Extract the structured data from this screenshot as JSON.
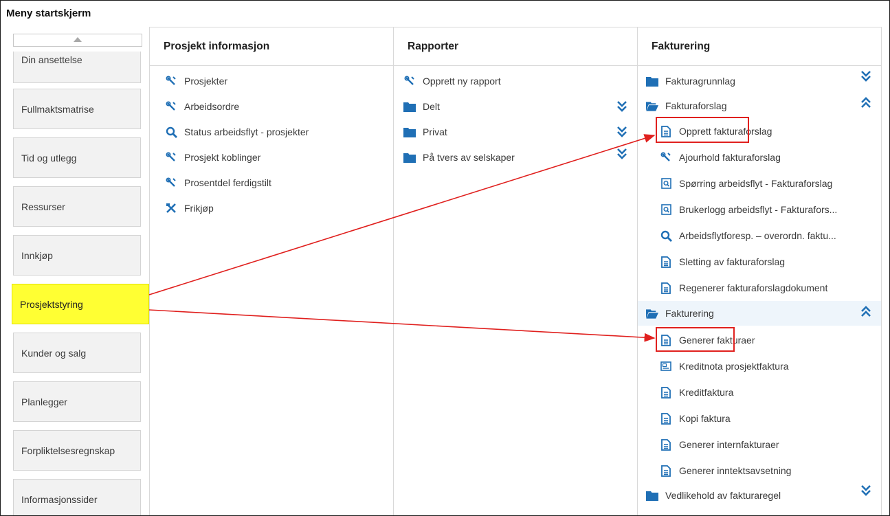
{
  "window_title": "Meny startskjerm",
  "sidebar": {
    "items": [
      {
        "label": "Din ansettelse"
      },
      {
        "label": "Fullmaktsmatrise"
      },
      {
        "label": "Tid og utlegg"
      },
      {
        "label": "Ressurser"
      },
      {
        "label": "Innkjøp"
      },
      {
        "label": "Prosjektstyring",
        "active": true
      },
      {
        "label": "Kunder og salg"
      },
      {
        "label": "Planlegger"
      },
      {
        "label": "Forpliktelsesregnskap"
      },
      {
        "label": "Informasjonssider"
      }
    ]
  },
  "columns": {
    "prosjekt": {
      "title": "Prosjekt informasjon",
      "items": [
        {
          "label": "Prosjekter",
          "icon": "tools-icon"
        },
        {
          "label": "Arbeidsordre",
          "icon": "tools-icon"
        },
        {
          "label": "Status arbeidsflyt - prosjekter",
          "icon": "search-icon"
        },
        {
          "label": "Prosjekt koblinger",
          "icon": "tools-icon"
        },
        {
          "label": "Prosentdel ferdigstilt",
          "icon": "tools-icon"
        },
        {
          "label": "Frikjøp",
          "icon": "tools-cross-icon"
        }
      ]
    },
    "rapporter": {
      "title": "Rapporter",
      "items": [
        {
          "label": "Opprett ny rapport",
          "icon": "tools-icon"
        },
        {
          "label": "Delt",
          "icon": "folder-icon"
        },
        {
          "label": "Privat",
          "icon": "folder-icon"
        },
        {
          "label": "På tvers av selskaper",
          "icon": "folder-icon"
        }
      ]
    },
    "fakturering": {
      "title": "Fakturering",
      "items": [
        {
          "label": "Fakturagrunnlag",
          "icon": "folder-icon"
        },
        {
          "label": "Fakturaforslag",
          "icon": "folder-open-icon"
        },
        {
          "label": "Opprett fakturaforslag",
          "icon": "document-icon"
        },
        {
          "label": "Ajourhold fakturaforslag",
          "icon": "tools-icon"
        },
        {
          "label": "Spørring arbeidsflyt - Fakturaforslag",
          "icon": "query-document-icon"
        },
        {
          "label": "Brukerlogg arbeidsflyt - Fakturafors...",
          "icon": "query-document-icon"
        },
        {
          "label": "Arbeidsflytforesp. – overordn. faktu...",
          "icon": "search-icon"
        },
        {
          "label": "Sletting av fakturaforslag",
          "icon": "document-icon"
        },
        {
          "label": "Regenerer fakturaforslagdokument",
          "icon": "document-icon"
        },
        {
          "label": "Fakturering",
          "icon": "folder-open-icon"
        },
        {
          "label": "Generer fakturaer",
          "icon": "document-icon"
        },
        {
          "label": "Kreditnota prosjektfaktura",
          "icon": "form-icon"
        },
        {
          "label": "Kreditfaktura",
          "icon": "document-icon"
        },
        {
          "label": "Kopi faktura",
          "icon": "document-icon"
        },
        {
          "label": "Generer internfakturaer",
          "icon": "document-icon"
        },
        {
          "label": "Generer inntektsavsetning",
          "icon": "document-icon"
        },
        {
          "label": "Vedlikehold av fakturaregel",
          "icon": "folder-icon"
        }
      ]
    }
  },
  "colors": {
    "accent": "#1f6fb5",
    "highlight": "#ffff33",
    "annotation": "#e0201e"
  }
}
